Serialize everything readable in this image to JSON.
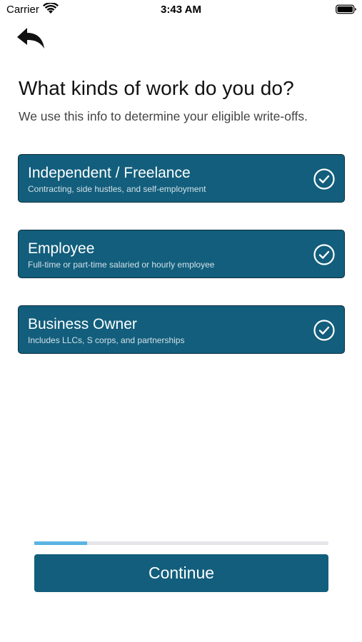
{
  "status_bar": {
    "carrier": "Carrier",
    "time": "3:43 AM",
    "wifi_icon": "wifi-icon",
    "battery_icon": "battery-icon"
  },
  "nav": {
    "back_icon": "back-arrow-icon"
  },
  "header": {
    "title": "What kinds of work do you do?",
    "subtitle": "We use this info to determine your eligible write-offs."
  },
  "options": [
    {
      "title": "Independent / Freelance",
      "description": "Contracting, side hustles, and self-employment",
      "selected": true,
      "icon": "check-circle-icon"
    },
    {
      "title": "Employee",
      "description": "Full-time or part-time salaried or hourly employee",
      "selected": true,
      "icon": "check-circle-icon"
    },
    {
      "title": "Business Owner",
      "description": "Includes LLCs, S corps, and partnerships",
      "selected": true,
      "icon": "check-circle-icon"
    }
  ],
  "progress": {
    "fraction": 0.18
  },
  "footer": {
    "continue_label": "Continue"
  },
  "colors": {
    "accent": "#125e7c",
    "progress_fill": "#59b3e3",
    "progress_track": "#e5e5ea"
  }
}
